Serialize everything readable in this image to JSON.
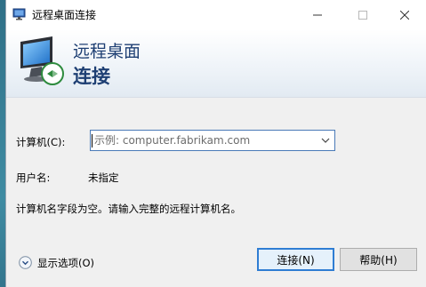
{
  "window": {
    "title": "远程桌面连接"
  },
  "banner": {
    "title_line1": "远程桌面",
    "title_line2": "连接"
  },
  "form": {
    "computer_label": "计算机(C):",
    "computer_placeholder": "示例: computer.fabrikam.com",
    "username_label": "用户名:",
    "username_value": "未指定",
    "message": "计算机名字段为空。请输入完整的远程计算机名。"
  },
  "footer": {
    "show_options_label": "显示选项(O)",
    "connect_label": "连接(N)",
    "help_label": "帮助(H)"
  },
  "icons": {
    "app": "remote-desktop-icon",
    "minimize": "minimize-icon",
    "maximize": "maximize-icon",
    "close": "close-icon",
    "dropdown": "chevron-down-icon",
    "options": "expand-circle-icon"
  },
  "colors": {
    "banner_title": "#1e3f73",
    "focus_border": "#2f7dd3"
  }
}
